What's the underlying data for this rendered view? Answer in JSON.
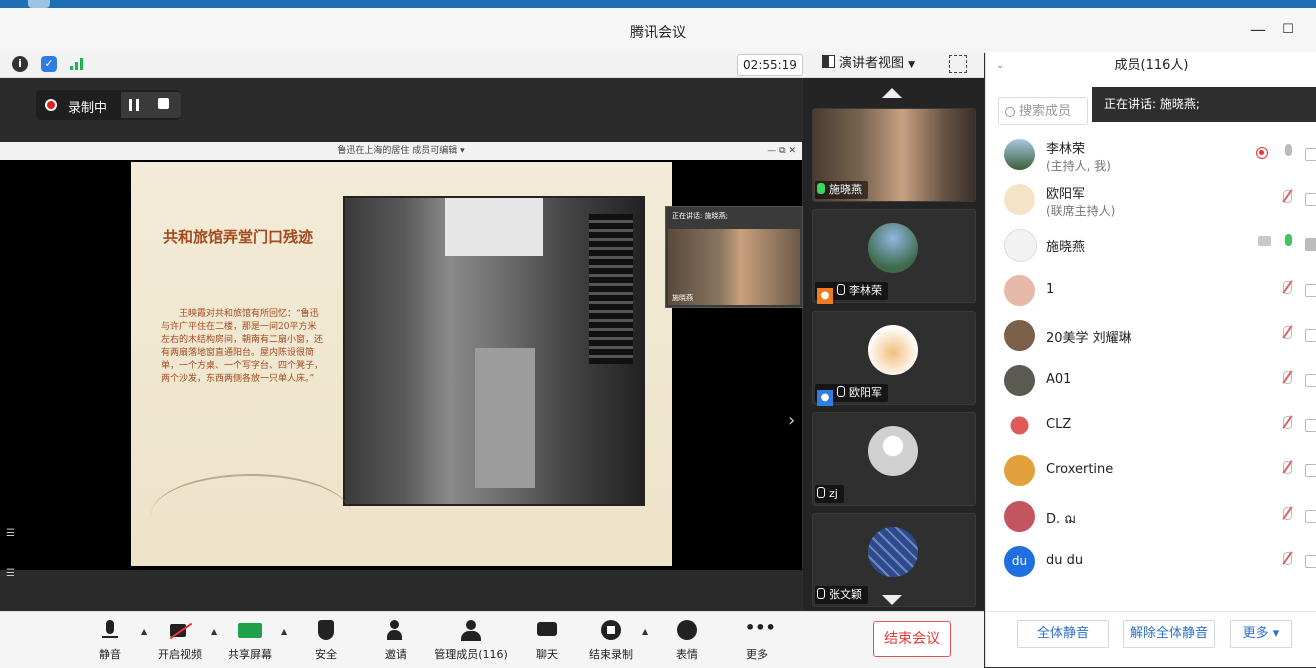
{
  "window": {
    "title": "腾讯会议",
    "minimize": "—",
    "maximize": "☐"
  },
  "topbar": {
    "timer": "02:55:19",
    "view_label": "演讲者视图"
  },
  "recording": {
    "label": "录制中"
  },
  "shared": {
    "window_title": "鲁迅在上海的居住  成员可编辑 ▾",
    "win_controls": "—  ⧉  ✕",
    "slide_title": "共和旅馆弄堂门口残迹",
    "slide_body": "王映霞对共和旅馆有所回忆：“鲁迅与许广平住在二楼，那是一间20平方米左右的木结构房间，朝南有二扇小窗，还有两扇落地窗直通阳台。屋内陈设很简单，一个方桌、一个写字台、四个凳子，两个沙发，东西两侧各放一只单人床。”",
    "mini_label": "正在讲话: 施晓燕;",
    "mini_name": "施晓燕"
  },
  "thumbnails": [
    {
      "name": "施晓燕"
    },
    {
      "name": "李林荣"
    },
    {
      "name": "欧阳军"
    },
    {
      "name": "zj"
    },
    {
      "name": "张文颖"
    }
  ],
  "toolbar": {
    "mute": "静音",
    "video": "开启视频",
    "share": "共享屏幕",
    "security": "安全",
    "invite": "邀请",
    "manage": "管理成员(116)",
    "chat": "聊天",
    "end_record": "结束录制",
    "reaction": "表情",
    "more": "更多",
    "end_meeting": "结束会议"
  },
  "panel": {
    "title": "成员(116人)",
    "search_placeholder": "搜索成员",
    "speaking": "正在讲话: 施晓燕;",
    "members": [
      {
        "name": "李林荣",
        "role": "(主持人, 我)",
        "avatar_color": "#4a6f8a"
      },
      {
        "name": "欧阳军",
        "role": "(联席主持人)",
        "avatar_color": "#e8c9a0"
      },
      {
        "name": "施晓燕",
        "role": "",
        "avatar_color": "#dddddd"
      },
      {
        "name": "1",
        "role": "",
        "avatar_color": "#e7b9a8"
      },
      {
        "name": "20美学 刘耀琳",
        "role": "",
        "avatar_color": "#7a6048"
      },
      {
        "name": "A01",
        "role": "",
        "avatar_color": "#5a5a50"
      },
      {
        "name": "CLZ",
        "role": "",
        "avatar_color": "#e05a5a"
      },
      {
        "name": "Croxertine",
        "role": "",
        "avatar_color": "#e2a13c"
      },
      {
        "name": "D. ฌ",
        "role": "",
        "avatar_color": "#c2555e"
      },
      {
        "name": "du du",
        "role": "",
        "avatar_color": "#1f6fe0",
        "initials": "du"
      }
    ],
    "mute_all": "全体静音",
    "unmute_all": "解除全体静音",
    "more": "更多 ▾"
  }
}
